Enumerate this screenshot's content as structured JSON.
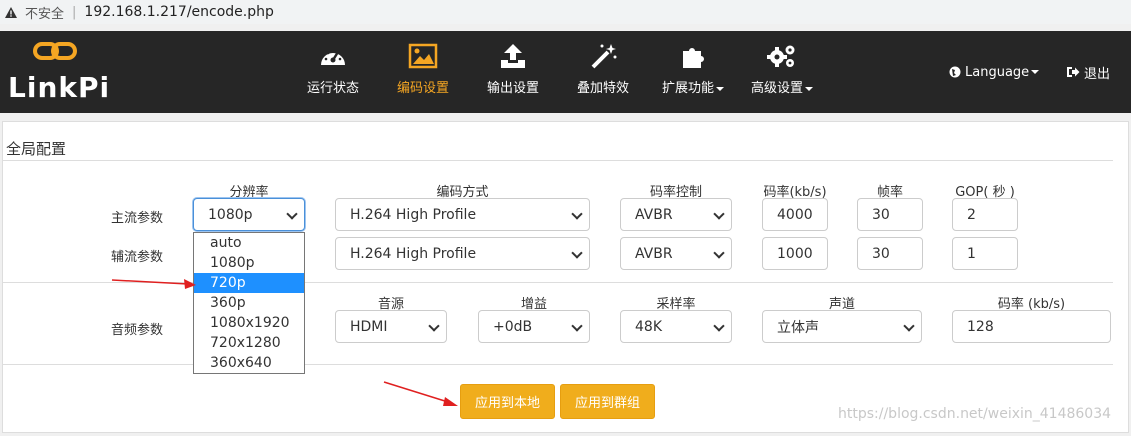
{
  "browser": {
    "insecure_label": "不安全",
    "url": "192.168.1.217/encode.php"
  },
  "brand": {
    "name": "LinkPi",
    "accent": "#f5a623"
  },
  "nav": {
    "items": [
      {
        "label": "运行状态",
        "icon": "dashboard-icon"
      },
      {
        "label": "编码设置",
        "icon": "image-icon",
        "active": true
      },
      {
        "label": "输出设置",
        "icon": "upload-icon"
      },
      {
        "label": "叠加特效",
        "icon": "magic-wand-icon"
      },
      {
        "label": "扩展功能",
        "icon": "puzzle-icon"
      },
      {
        "label": "高级设置",
        "icon": "gears-icon"
      }
    ],
    "language": "Language",
    "logout": "退出"
  },
  "panel": {
    "title": "全局配置",
    "video_headers": {
      "resolution": "分辨率",
      "codec": "编码方式",
      "rate_control": "码率控制",
      "bitrate": "码率(kb/s)",
      "framerate": "帧率",
      "gop": "GOP( 秒 )"
    },
    "main": {
      "label": "主流参数",
      "resolution": "1080p",
      "codec": "H.264 High Profile",
      "rate_control": "AVBR",
      "bitrate": "4000",
      "framerate": "30",
      "gop": "2"
    },
    "sub": {
      "label": "辅流参数",
      "codec": "H.264 High Profile",
      "rate_control": "AVBR",
      "bitrate": "1000",
      "framerate": "30",
      "gop": "1"
    },
    "audio_headers": {
      "source": "音源",
      "gain": "增益",
      "samplerate": "采样率",
      "channels": "声道",
      "bitrate": "码率 (kb/s)"
    },
    "audio": {
      "label": "音频参数",
      "source": "HDMI",
      "gain": "+0dB",
      "samplerate": "48K",
      "channels": "立体声",
      "bitrate": "128"
    },
    "resolution_options": [
      "auto",
      "1080p",
      "720p",
      "360p",
      "1080x1920",
      "720x1280",
      "360x640"
    ],
    "highlighted_option": "720p",
    "buttons": {
      "apply_local": "应用到本地",
      "apply_group": "应用到群组"
    }
  },
  "watermark": "https://blog.csdn.net/weixin_41486034"
}
